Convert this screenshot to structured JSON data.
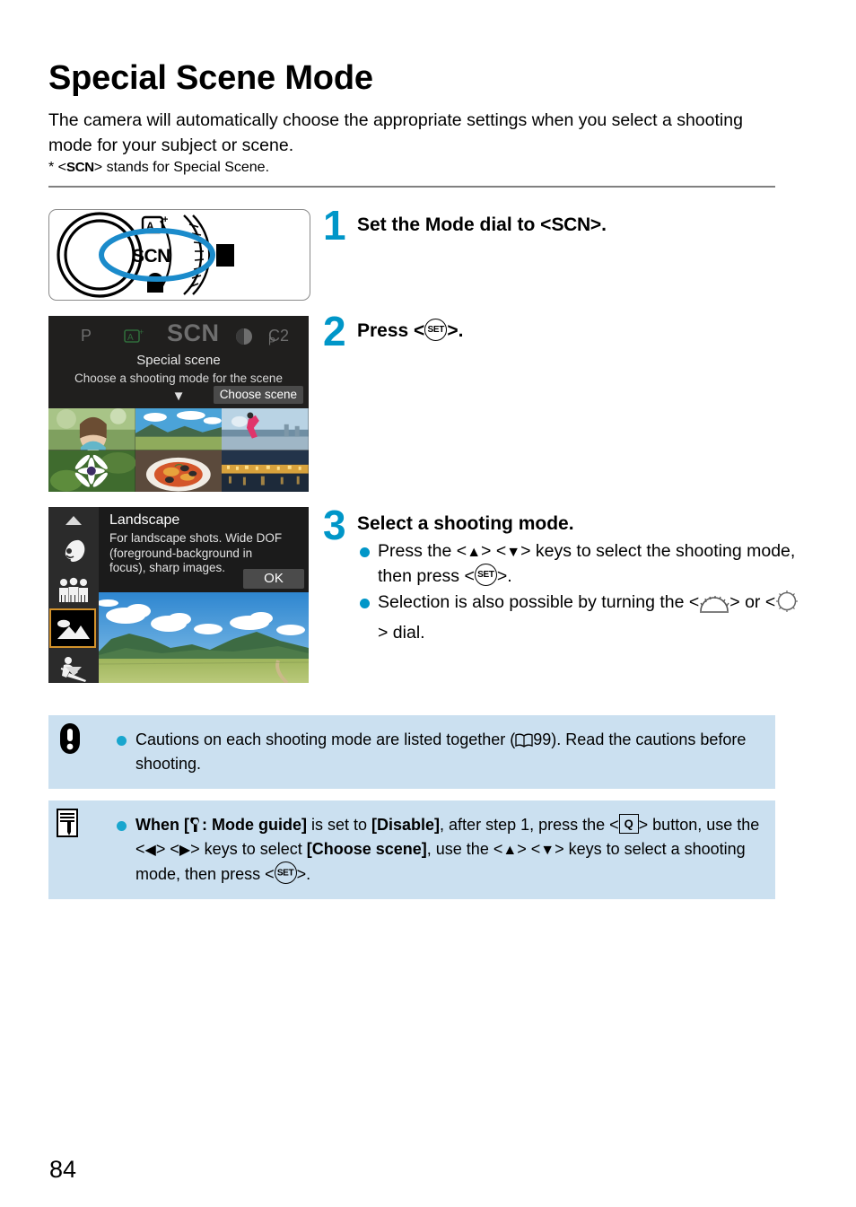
{
  "page": {
    "title": "Special Scene Mode",
    "intro": "The camera will automatically choose the appropriate settings when you select a shooting mode for your subject or scene.",
    "footnote_prefix": "* <",
    "footnote_symbol": "SCN",
    "footnote_suffix": "> stands for Special Scene.",
    "page_number": "84"
  },
  "steps": [
    {
      "number": "1",
      "heading_before": "Set the Mode dial to <",
      "heading_symbol": "SCN",
      "heading_after": ">."
    },
    {
      "number": "2",
      "heading_before": "Press <",
      "heading_symbol": "SET",
      "heading_after": ">."
    },
    {
      "number": "3",
      "heading": "Select a shooting mode.",
      "bullets": [
        {
          "part1": "Press the <",
          "key1": "▲",
          "part2": "> <",
          "key2": "▼",
          "part3": "> keys to select the shooting mode, then press <",
          "icon": "SET",
          "part4": ">."
        },
        {
          "part1": "Selection is also possible by turning the <",
          "dial1": "main-dial",
          "part2": "> or <",
          "dial2": "quick-control-dial",
          "part3": "> dial."
        }
      ]
    }
  ],
  "dial_figure": {
    "selected_label": "SCN",
    "above_label": "A",
    "above_superscript": "+",
    "highlight_color": "#1B8BCB"
  },
  "mode_guide_screen": {
    "modes": [
      "P",
      "A+",
      "SCN",
      "filter",
      "C2P"
    ],
    "mode_p": "P",
    "mode_auto": "A",
    "mode_auto_sup": "+",
    "mode_scn": "SCN",
    "mode_c2": "C2",
    "mode_c2_sub": "P",
    "title": "Special scene",
    "description": "Choose a shooting mode for the scene",
    "caret": "▼",
    "button": "Choose scene",
    "thumbnails": [
      "portrait",
      "landscape",
      "sports",
      "close-up",
      "food",
      "night-scene"
    ]
  },
  "scene_select_screen": {
    "sidebar_icons": [
      "scroll-up-arrow",
      "portrait-icon",
      "group-photo-icon",
      "landscape-icon",
      "sports-icon",
      "scroll-down-arrow"
    ],
    "selected_icon": "landscape-icon",
    "scene_name": "Landscape",
    "scene_description": "For landscape shots. Wide DOF (foreground-background in focus), sharp images.",
    "ok_button": "OK"
  },
  "caution_box": {
    "icon": "caution-icon",
    "part1": "Cautions on each shooting mode are listed together (",
    "reference_icon": "book-icon",
    "reference_page": "99",
    "part2": "). Read the cautions before shooting."
  },
  "note_box": {
    "icon": "note-icon",
    "line1_a": "When [",
    "line1_wrench": "wrench-icon",
    "line1_b": ": Mode guide]",
    "line1_c": " is set to ",
    "line1_d": "[Disable]",
    "line1_e": ", after step 1, press the <",
    "line1_q": "Q",
    "line1_f": "> button, use the <",
    "line1_left": "◀",
    "line1_g": "> <",
    "line1_right": "▶",
    "line1_h": "> keys to select ",
    "line1_i": "[Choose scene]",
    "line1_j": ", use the <",
    "line1_up": "▲",
    "line1_k": "> <",
    "line1_down": "▼",
    "line1_l": "> keys to select a shooting mode, then press <",
    "line1_set": "SET",
    "line1_m": ">."
  },
  "colors": {
    "accent": "#0096C8",
    "bullet": "#19A6CE",
    "infobox_bg": "#CBE0F0",
    "selection_border": "#D4932C"
  }
}
